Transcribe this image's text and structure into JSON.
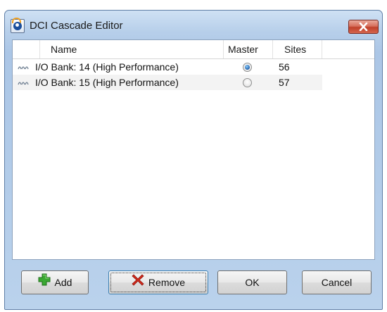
{
  "window": {
    "title": "DCI Cascade Editor"
  },
  "table": {
    "columns": [
      "Name",
      "Master",
      "Sites"
    ],
    "rows": [
      {
        "name": "I/O Bank: 14 (High Performance)",
        "master": true,
        "sites": "56"
      },
      {
        "name": "I/O Bank: 15 (High Performance)",
        "master": false,
        "sites": "57"
      }
    ]
  },
  "buttons": {
    "add": "Add",
    "remove": "Remove",
    "ok": "OK",
    "cancel": "Cancel"
  },
  "icons": {
    "window": "vivado-app-icon",
    "close": "close-icon",
    "row": "io-bank-icon",
    "add": "plus-icon",
    "remove": "x-icon"
  },
  "colors": {
    "title_bar": "#b7cfea",
    "close_button": "#c0402a",
    "add_icon": "#3aa832",
    "remove_icon": "#d42a1c",
    "radio_selected": "#1f5ea8"
  }
}
